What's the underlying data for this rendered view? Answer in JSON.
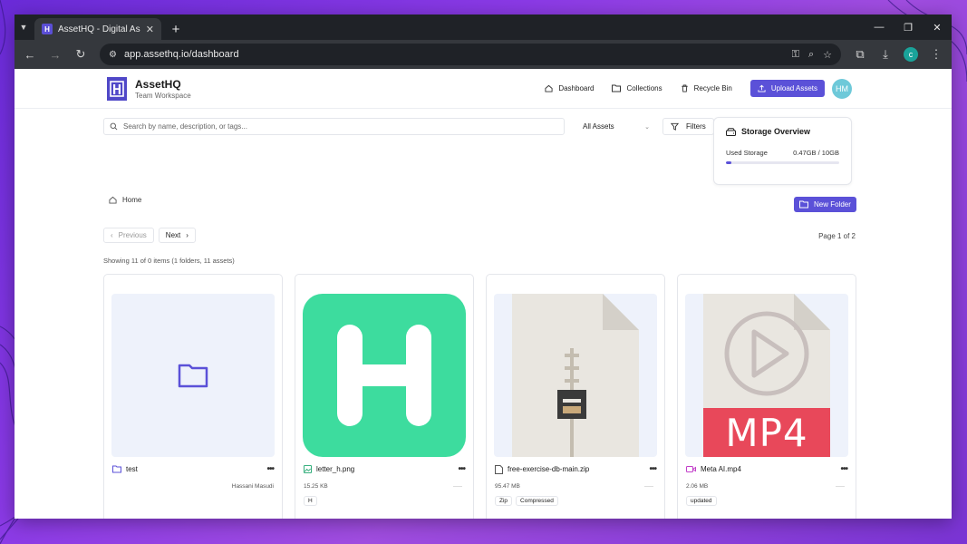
{
  "browser": {
    "tab_title": "AssetHQ - Digital Asset Manage",
    "url": "app.assethq.io/dashboard",
    "profile_initial": "c"
  },
  "header": {
    "brand_name": "AssetHQ",
    "brand_sub": "Team Workspace",
    "nav": {
      "dashboard": "Dashboard",
      "collections": "Collections",
      "recycle_bin": "Recycle Bin"
    },
    "upload_label": "Upload Assets",
    "avatar_initials": "HM"
  },
  "search": {
    "placeholder": "Search by name, description, or tags...",
    "filter_select": "All Assets",
    "filters_label": "Filters"
  },
  "storage": {
    "title": "Storage Overview",
    "used_label": "Used Storage",
    "used_value": "0.47GB / 10GB",
    "used_fraction": 0.047
  },
  "breadcrumb": {
    "home": "Home"
  },
  "new_folder_label": "New Folder",
  "pagination": {
    "previous": "Previous",
    "next": "Next",
    "page_info": "Page 1 of 2"
  },
  "showing_text": "Showing 11 of 0 items (1 folders, 11 assets)",
  "cards": [
    {
      "name": "test",
      "owner": "Hassani Masudi"
    },
    {
      "name": "letter_h.png",
      "size": "15.25 KB",
      "tags": [
        "H"
      ]
    },
    {
      "name": "free-exercise-db-main.zip",
      "size": "95.47 MB",
      "tags": [
        "Zip",
        "Compressed"
      ]
    },
    {
      "name": "Meta AI.mp4",
      "size": "2.06 MB",
      "tags": [
        "updated"
      ],
      "badge": "MP4"
    }
  ],
  "colors": {
    "accent": "#5b51d8",
    "image_thumb": "#3ddc9e",
    "video_badge": "#e8485a"
  }
}
